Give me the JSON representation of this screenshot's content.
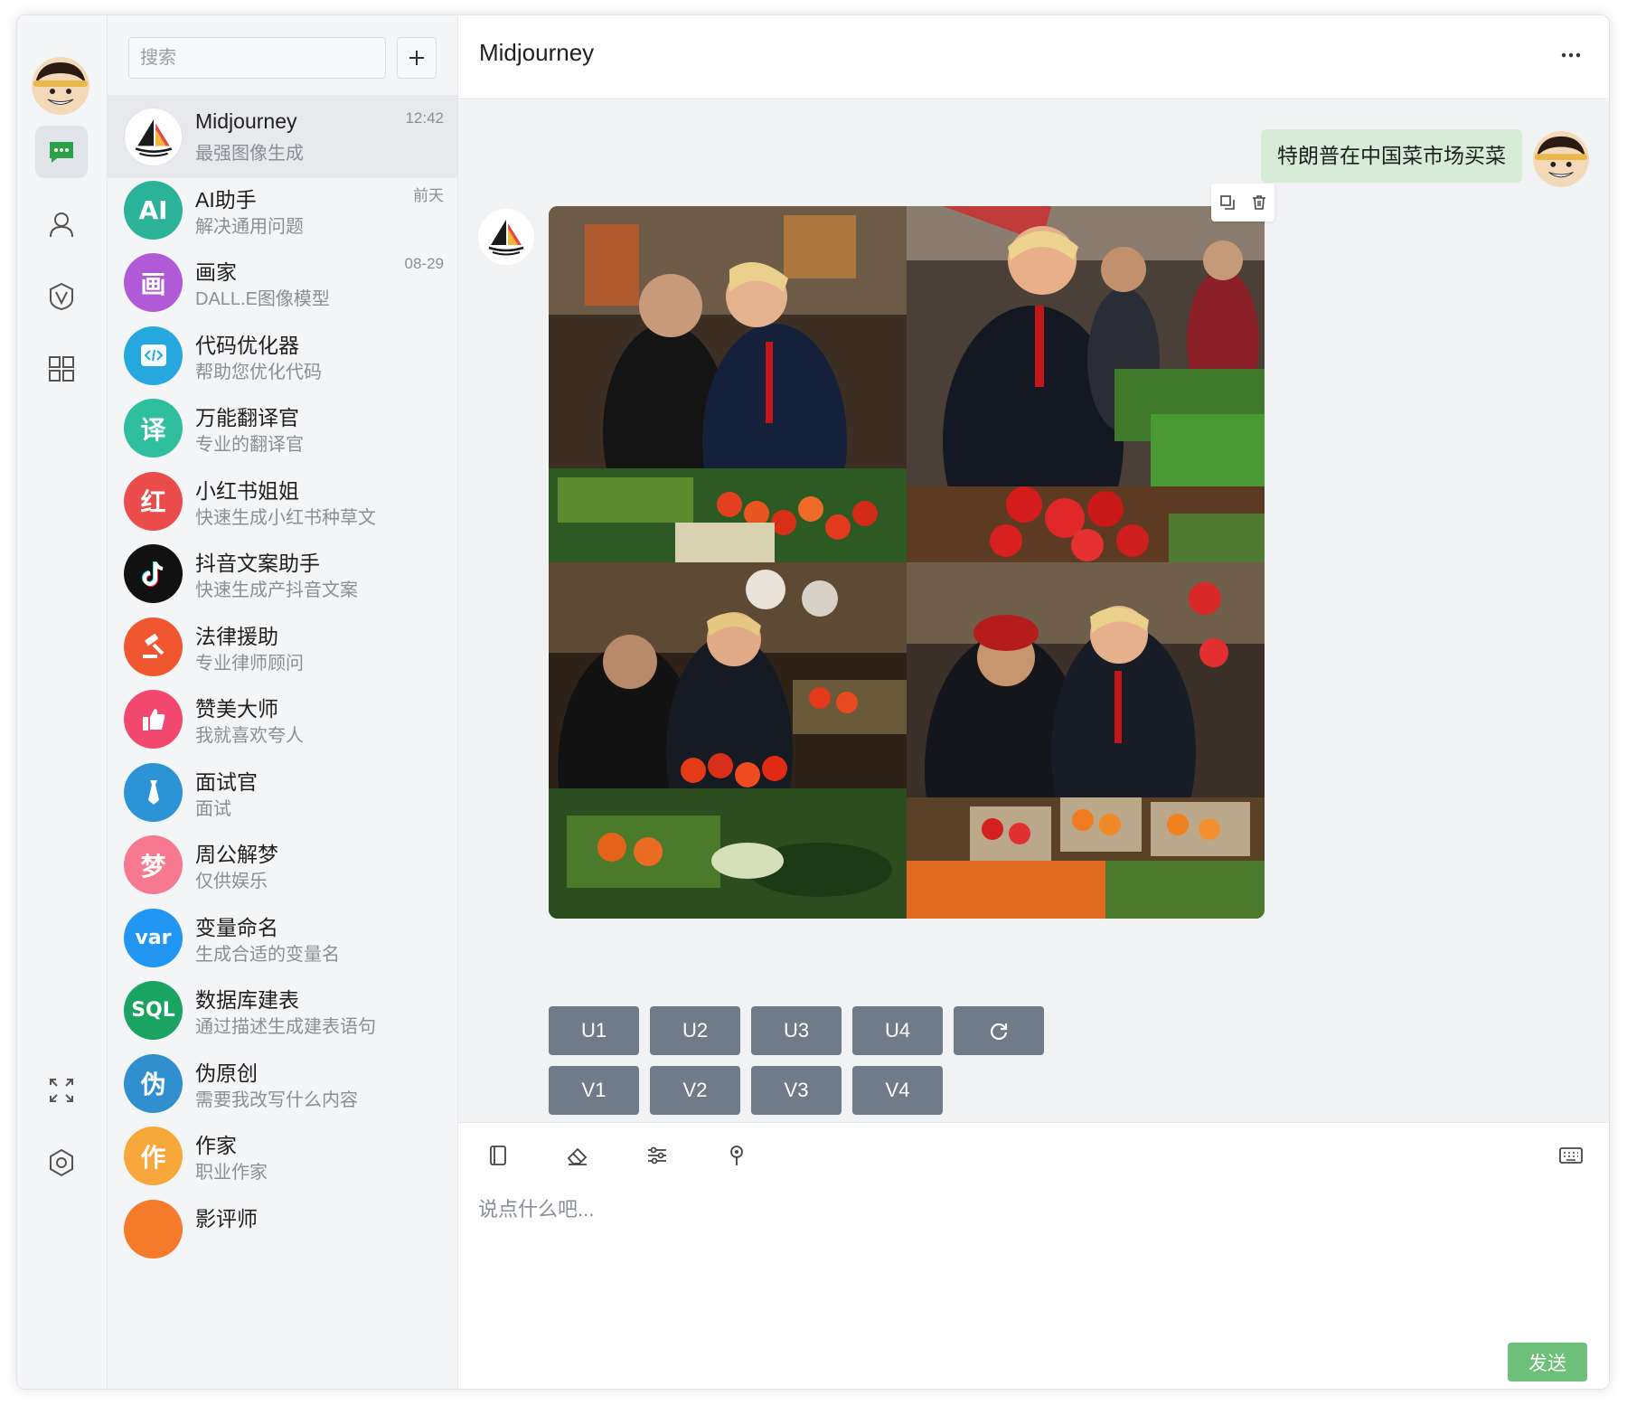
{
  "search": {
    "placeholder": "搜索"
  },
  "header": {
    "title": "Midjourney"
  },
  "conversations": [
    {
      "name": "Midjourney",
      "subtitle": "最强图像生成",
      "time": "12:42",
      "avatar_icon": "sailboat-icon",
      "avatar_color": "#ffffff"
    },
    {
      "name": "AI助手",
      "subtitle": "解决通用问题",
      "time": "前天",
      "avatar_text": "AI",
      "avatar_color": "#2bb39a"
    },
    {
      "name": "画家",
      "subtitle": "DALL.E图像模型",
      "time": "08-29",
      "avatar_text": "画",
      "avatar_color": "#b05ad8"
    },
    {
      "name": "代码优化器",
      "subtitle": "帮助您优化代码",
      "time": "",
      "avatar_icon": "code-icon",
      "avatar_color": "#26a7de"
    },
    {
      "name": "万能翻译官",
      "subtitle": "专业的翻译官",
      "time": "",
      "avatar_text": "译",
      "avatar_color": "#2fbf9f"
    },
    {
      "name": "小红书姐姐",
      "subtitle": "快速生成小红书种草文",
      "time": "",
      "avatar_text": "红",
      "avatar_color": "#ec4b4b"
    },
    {
      "name": "抖音文案助手",
      "subtitle": "快速生成产抖音文案",
      "time": "",
      "avatar_icon": "tiktok-icon",
      "avatar_color": "#111111"
    },
    {
      "name": "法律援助",
      "subtitle": "专业律师顾问",
      "time": "",
      "avatar_icon": "gavel-icon",
      "avatar_color": "#f0562f"
    },
    {
      "name": "赞美大师",
      "subtitle": "我就喜欢夸人",
      "time": "",
      "avatar_icon": "thumbs-up-icon",
      "avatar_color": "#f2486d"
    },
    {
      "name": "面试官",
      "subtitle": "面试",
      "time": "",
      "avatar_icon": "tie-icon",
      "avatar_color": "#2b93d6"
    },
    {
      "name": "周公解梦",
      "subtitle": "仅供娱乐",
      "time": "",
      "avatar_text": "梦",
      "avatar_color": "#f6798f"
    },
    {
      "name": "变量命名",
      "subtitle": "生成合适的变量名",
      "time": "",
      "avatar_text": "var",
      "avatar_color": "#2196f3"
    },
    {
      "name": "数据库建表",
      "subtitle": "通过描述生成建表语句",
      "time": "",
      "avatar_text": "SQL",
      "avatar_color": "#1aa361"
    },
    {
      "name": "伪原创",
      "subtitle": "需要我改写什么内容",
      "time": "",
      "avatar_text": "伪",
      "avatar_color": "#2f8fcf"
    },
    {
      "name": "作家",
      "subtitle": "职业作家",
      "time": "",
      "avatar_text": "作",
      "avatar_color": "#f8a73a"
    },
    {
      "name": "影评师",
      "subtitle": "",
      "time": "",
      "avatar_text": "",
      "avatar_color": "#f57b2b"
    }
  ],
  "chat": {
    "user_message": "特朗普在中国菜市场买菜",
    "upscale_buttons": [
      "U1",
      "U2",
      "U3",
      "U4"
    ],
    "variation_buttons": [
      "V1",
      "V2",
      "V3",
      "V4"
    ],
    "reroll_icon": "refresh-icon"
  },
  "composer": {
    "placeholder": "说点什么吧...",
    "send_label": "发送",
    "send_color": "#6cc07a"
  },
  "rail": {
    "active_item": "chat",
    "accent": "#2ba245"
  }
}
